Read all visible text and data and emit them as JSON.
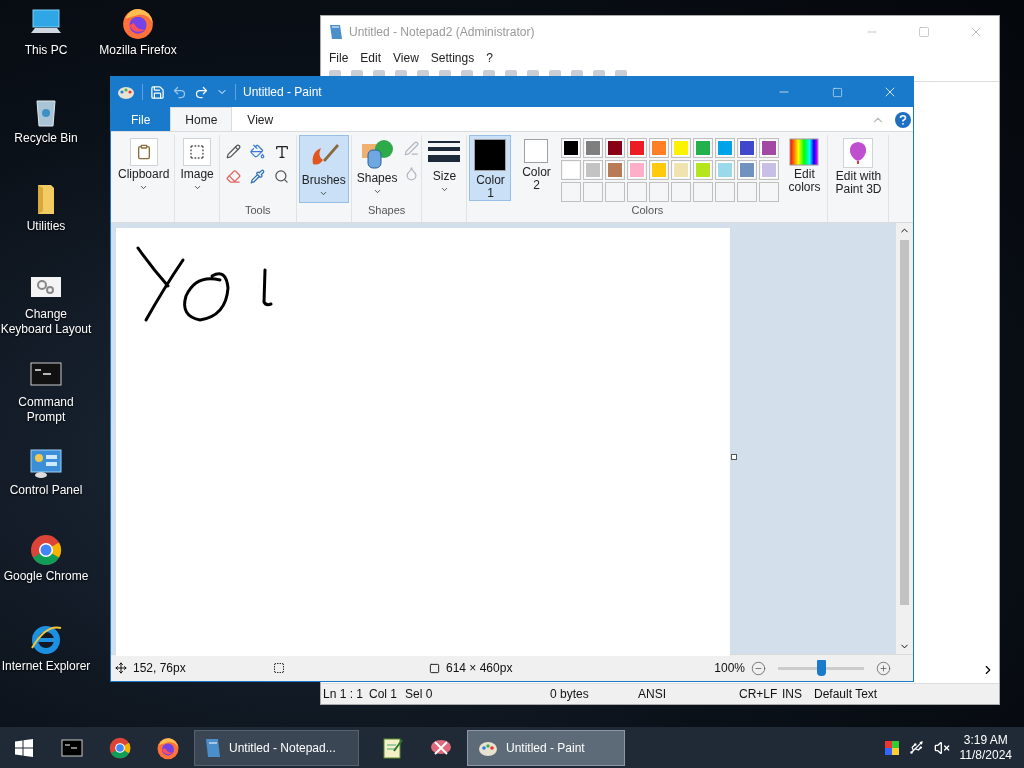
{
  "desktop_icons": [
    {
      "kind": "computer",
      "label": "This PC"
    },
    {
      "kind": "recycle",
      "label": "Recycle Bin"
    },
    {
      "kind": "folder",
      "label": "Utilities"
    },
    {
      "kind": "gears",
      "label": "Change Keyboard Layout"
    },
    {
      "kind": "console",
      "label": "Command Prompt"
    },
    {
      "kind": "control",
      "label": "Control Panel"
    },
    {
      "kind": "chrome",
      "label": "Google Chrome"
    },
    {
      "kind": "ie",
      "label": "Internet Explorer"
    },
    {
      "kind": "firefox",
      "label": "Mozilla Firefox"
    }
  ],
  "notepad": {
    "title": "Untitled - Notepad2 (Administrator)",
    "menu": [
      "File",
      "Edit",
      "View",
      "Settings",
      "?"
    ],
    "status_bar": [
      "Ln 1 : 1",
      "Col 1",
      "Sel 0",
      "0 bytes",
      "ANSI",
      "CR+LF",
      "INS",
      "Default Text"
    ]
  },
  "paint": {
    "title": "Untitled - Paint",
    "tabs": [
      {
        "label": "File",
        "kind": "file",
        "selected": false
      },
      {
        "label": "Home",
        "kind": "tab",
        "selected": true
      },
      {
        "label": "View",
        "kind": "tab",
        "selected": false
      }
    ],
    "clipboard": "Clipboard",
    "image": "Image",
    "tools_label": "Tools",
    "brushes": {
      "label": "Brushes",
      "selected": true
    },
    "shapes": "Shapes",
    "shapes_label": "Shapes",
    "size": "Size",
    "color1": {
      "label": "Color",
      "sub": "1",
      "color": "#000000",
      "selected": true
    },
    "color2": {
      "label": "Color",
      "sub": "2",
      "color": "#ffffff",
      "selected": false
    },
    "palette": [
      {
        "color": "#000000"
      },
      {
        "color": "#7f7f7f"
      },
      {
        "color": "#880015"
      },
      {
        "color": "#ed1c24"
      },
      {
        "color": "#ff7f27"
      },
      {
        "color": "#fff200"
      },
      {
        "color": "#22b14c"
      },
      {
        "color": "#00a2e8"
      },
      {
        "color": "#3f48cc"
      },
      {
        "color": "#a349a4"
      },
      {
        "color": "#ffffff"
      },
      {
        "color": "#c3c3c3"
      },
      {
        "color": "#b97a57"
      },
      {
        "color": "#ffaec9"
      },
      {
        "color": "#ffc90e"
      },
      {
        "color": "#efe4b0"
      },
      {
        "color": "#b5e61d"
      },
      {
        "color": "#99d9ea"
      },
      {
        "color": "#7092be"
      },
      {
        "color": "#c8bfe7"
      }
    ],
    "edit_colors": [
      "Edit",
      "colors"
    ],
    "colors_label": "Colors",
    "paint3d": [
      "Edit with",
      "Paint 3D"
    ],
    "status": {
      "cursor": "152, 76px",
      "canvas_size": "614 × 460px",
      "zoom": "100%",
      "zoom_slider": {
        "level": 0.5
      }
    }
  },
  "taskbar": {
    "items": [
      {
        "kind": "terminal"
      },
      {
        "kind": "chrome"
      },
      {
        "kind": "firefox"
      },
      {
        "kind": "notepad_window",
        "label": "Untitled - Notepad...",
        "selected": false
      },
      {
        "kind": "notepad"
      },
      {
        "kind": "snip"
      },
      {
        "kind": "paint_window",
        "label": "Untitled - Paint",
        "selected": true
      }
    ],
    "time": "3:19 AM",
    "date": "11/8/2024"
  }
}
